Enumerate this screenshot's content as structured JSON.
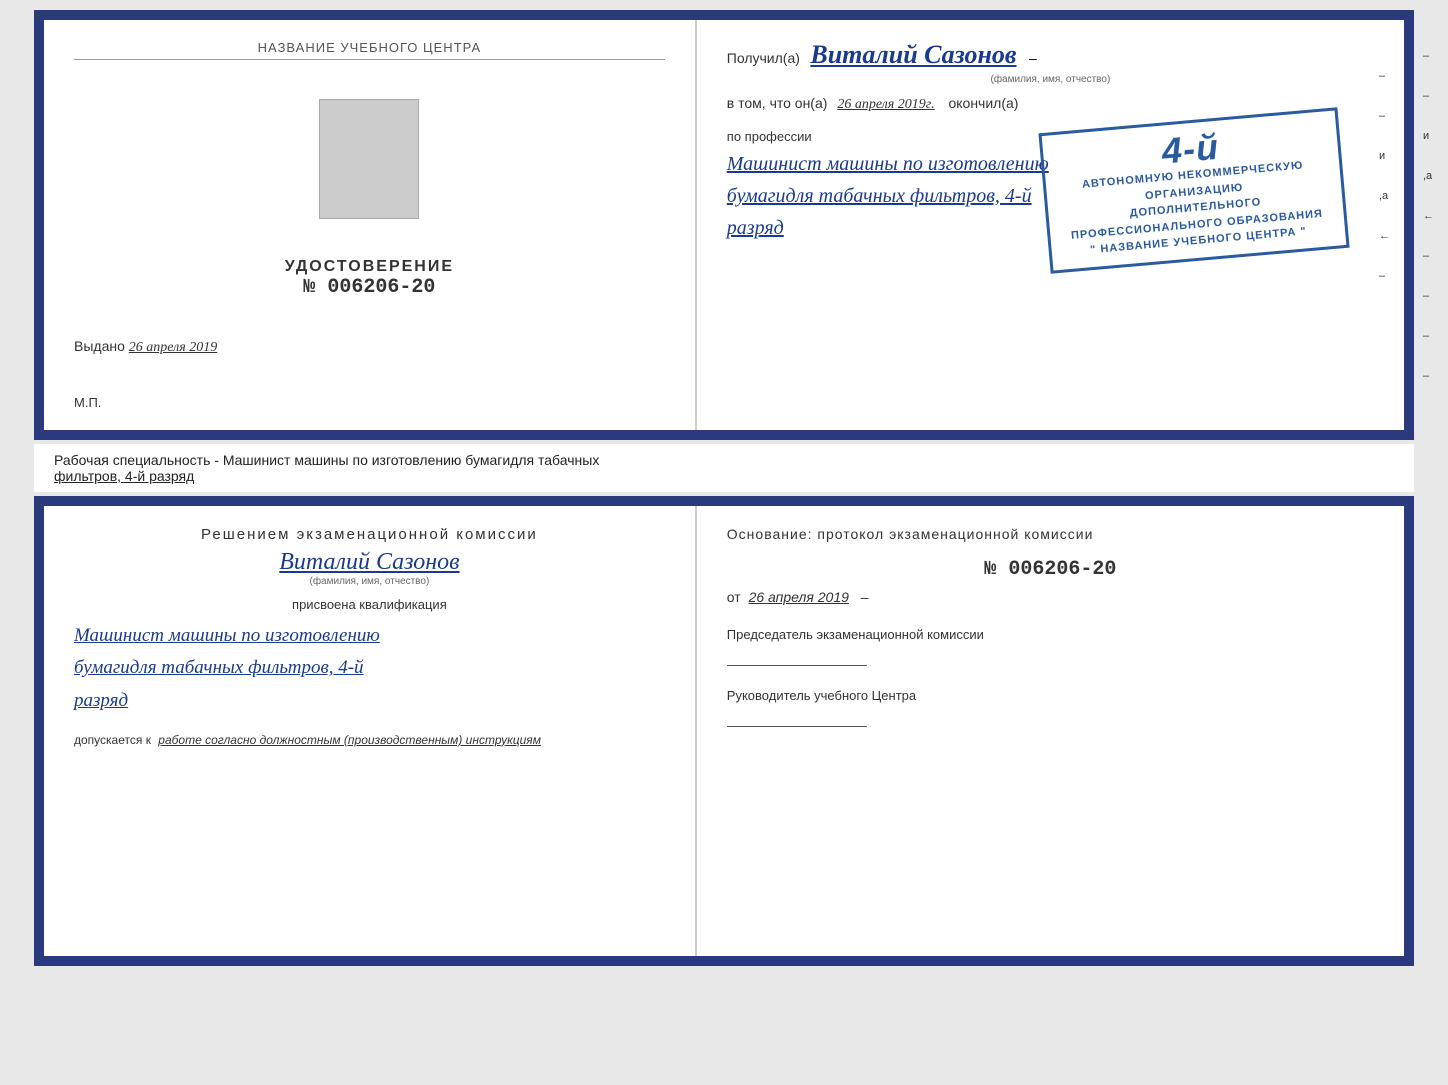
{
  "page": {
    "background_color": "#e8e8e8"
  },
  "top_cert": {
    "left": {
      "school_name_label": "НАЗВАНИЕ УЧЕБНОГО ЦЕНТРА",
      "udostoverenie_title": "УДОСТОВЕРЕНИЕ",
      "number": "№ 006206-20",
      "vydano_label": "Выдано",
      "vydano_date": "26 апреля 2019",
      "mp_label": "М.П."
    },
    "right": {
      "poluchil_prefix": "Получил(а)",
      "person_name": "Виталий Сазонов",
      "person_name_sub": "(фамилия, имя, отчество)",
      "v_tom_prefix": "в том, что он(а)",
      "date": "26 апреля 2019г.",
      "okonchil": "окончил(а)",
      "stamp_line1": "4-й",
      "stamp_line2": "АВТОНОМНУЮ НЕКОММЕРЧЕСКУЮ ОРГАНИЗАЦИЮ",
      "stamp_line3": "ДОПОЛНИТЕЛЬНОГО ПРОФЕССИОНАЛЬНОГО ОБРАЗОВАНИЯ",
      "stamp_line4": "\" НАЗВАНИЕ УЧЕБНОГО ЦЕНТРА \"",
      "po_professii": "по профессии",
      "profession1": "Машинист машины по изготовлению",
      "profession2": "бумагидля табачных фильтров, 4-й",
      "profession3": "разряд"
    }
  },
  "middle": {
    "text_prefix": "Рабочая специальность - Машинист машины по изготовлению бумагидля табачных",
    "text_suffix": "фильтров, 4-й разряд"
  },
  "bottom_cert": {
    "left": {
      "resheniem_title": "Решением  экзаменационной  комиссии",
      "person_name": "Виталий Сазонов",
      "fio_sub": "(фамилия, имя, отчество)",
      "prisvoyena": "присвоена квалификация",
      "profession1": "Машинист машины по изготовлению",
      "profession2": "бумагидля табачных фильтров, 4-й",
      "profession3": "разряд",
      "dopusk_prefix": "допускается к",
      "dopusk_text": "работе согласно должностным (производственным) инструкциям"
    },
    "right": {
      "osnovanie": "Основание: протокол экзаменационной  комиссии",
      "number": "№  006206-20",
      "ot_prefix": "от",
      "ot_date": "26 апреля 2019",
      "predsedatel_title": "Председатель экзаменационной комиссии",
      "rukovoditel_title": "Руководитель учебного Центра"
    }
  },
  "right_marks": {
    "items": [
      "–",
      "–",
      "и",
      ",а",
      "←",
      "–",
      "–",
      "–",
      "–"
    ]
  }
}
